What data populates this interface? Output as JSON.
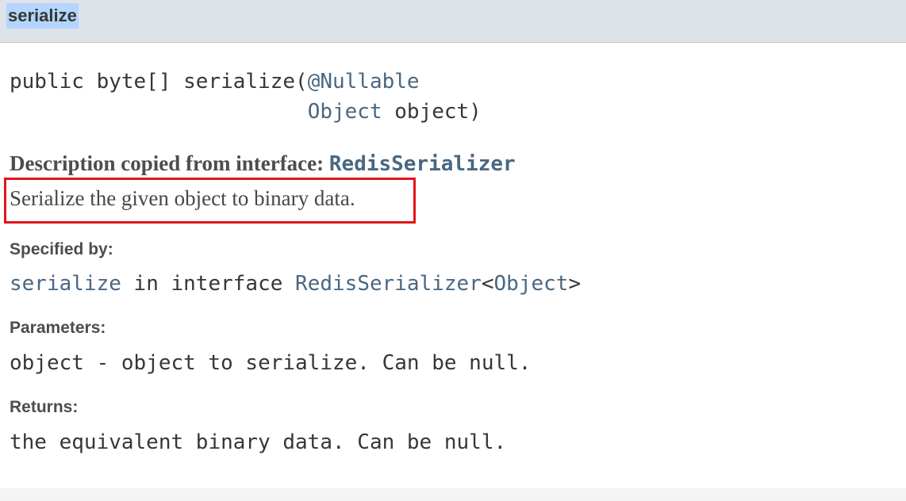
{
  "member": {
    "name": "serialize"
  },
  "signature": {
    "prefix": "public byte[] serialize(",
    "annotation": "@Nullable",
    "indent": "                        ",
    "param_type": "Object",
    "param_rest": " object)"
  },
  "description": {
    "heading": "Description copied from interface: ",
    "interface_link": "RedisSerializer",
    "text": "Serialize the given object to binary data."
  },
  "specified_by": {
    "label": "Specified by:",
    "method_link": "serialize",
    "middle": " in interface ",
    "interface_link": "RedisSerializer",
    "lt": "<",
    "type_arg_link": "Object",
    "gt": ">"
  },
  "parameters": {
    "label": "Parameters:",
    "text": "object - object to serialize. Can be null."
  },
  "returns": {
    "label": "Returns:",
    "text": "the equivalent binary data. Can be null."
  },
  "colors": {
    "header_bg": "#dee3e9",
    "selection_bg": "#b4d5fe",
    "link": "#4a6782",
    "highlight_box": "#e3141b"
  }
}
